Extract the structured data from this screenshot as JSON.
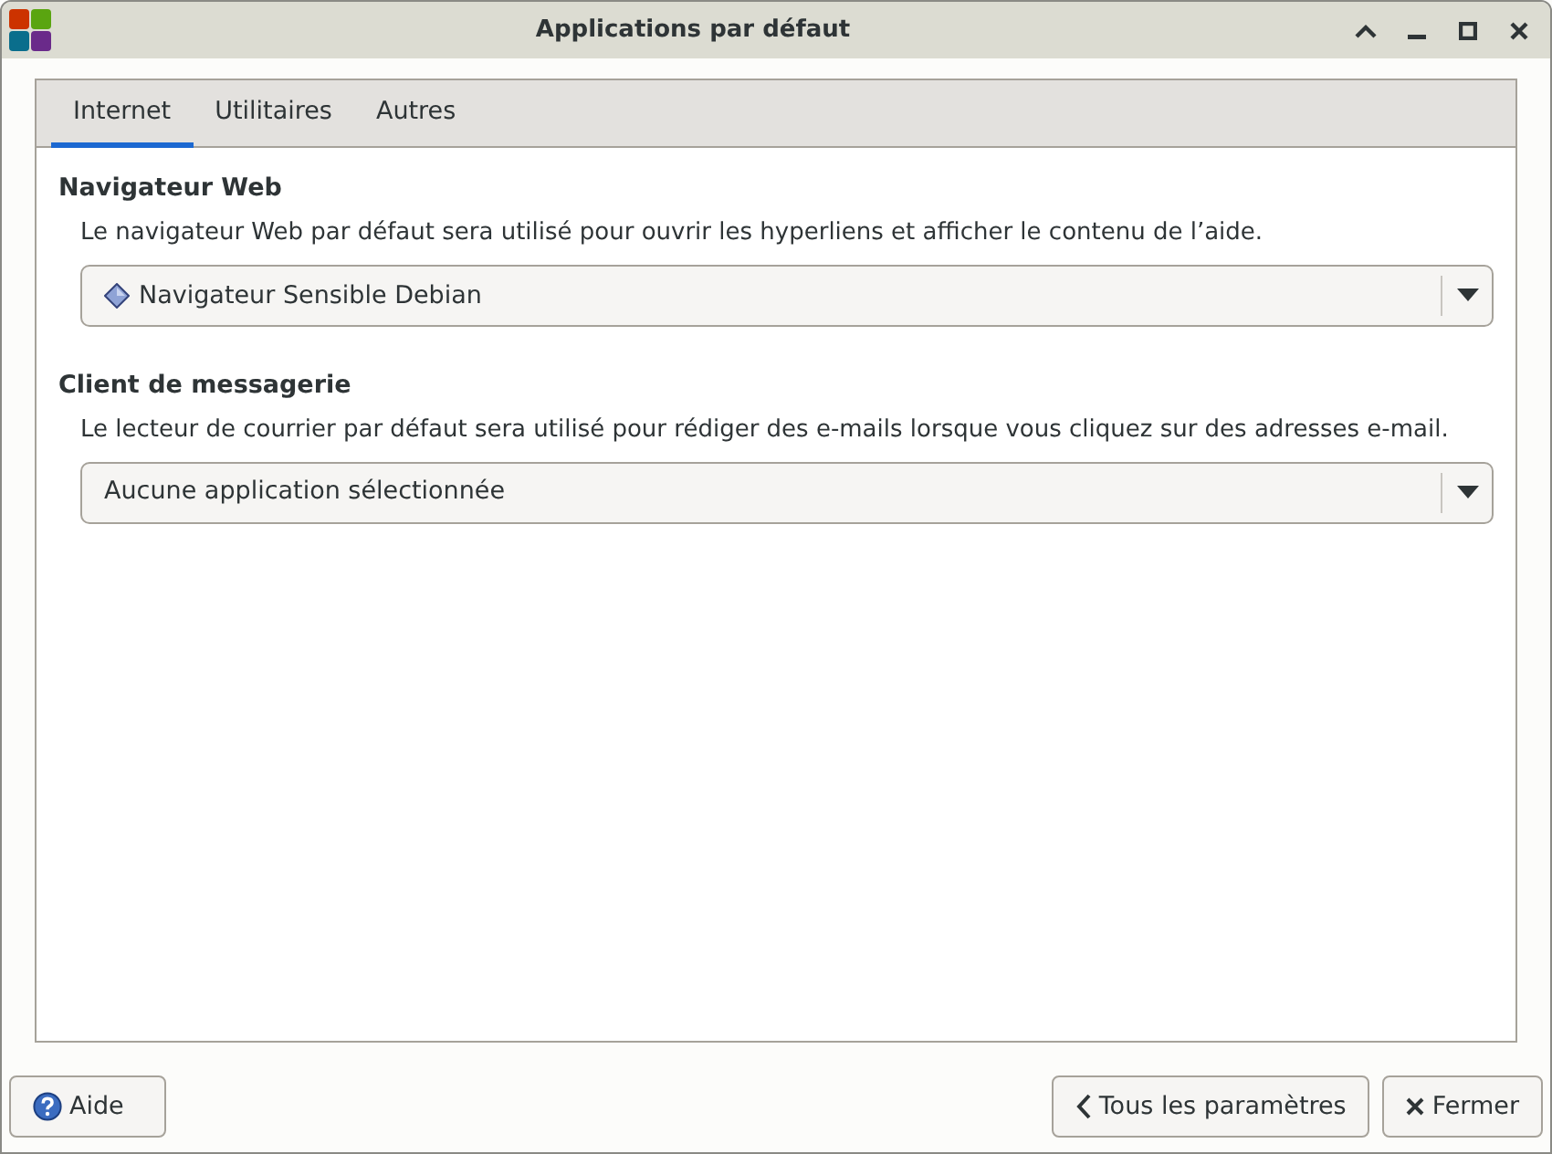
{
  "window": {
    "title": "Applications par défaut"
  },
  "tabs": [
    {
      "label": "Internet",
      "selected": true
    },
    {
      "label": "Utilitaires",
      "selected": false
    },
    {
      "label": "Autres",
      "selected": false
    }
  ],
  "sections": [
    {
      "heading": "Navigateur Web",
      "description": "Le navigateur Web par défaut sera utilisé pour ouvrir les hyperliens et afficher le contenu de l’aide.",
      "value": "Navigateur Sensible Debian",
      "has_icon": true
    },
    {
      "heading": "Client de messagerie",
      "description": "Le lecteur de courrier par défaut sera utilisé pour rédiger des e-mails lorsque vous cliquez sur des adresses e-mail.",
      "value": "Aucune application sélectionnée",
      "has_icon": false
    }
  ],
  "buttons": [
    {
      "label": "Aide",
      "kind": "help"
    },
    {
      "label": "Tous les paramètres",
      "kind": "back"
    },
    {
      "label": "Fermer",
      "kind": "close"
    }
  ]
}
